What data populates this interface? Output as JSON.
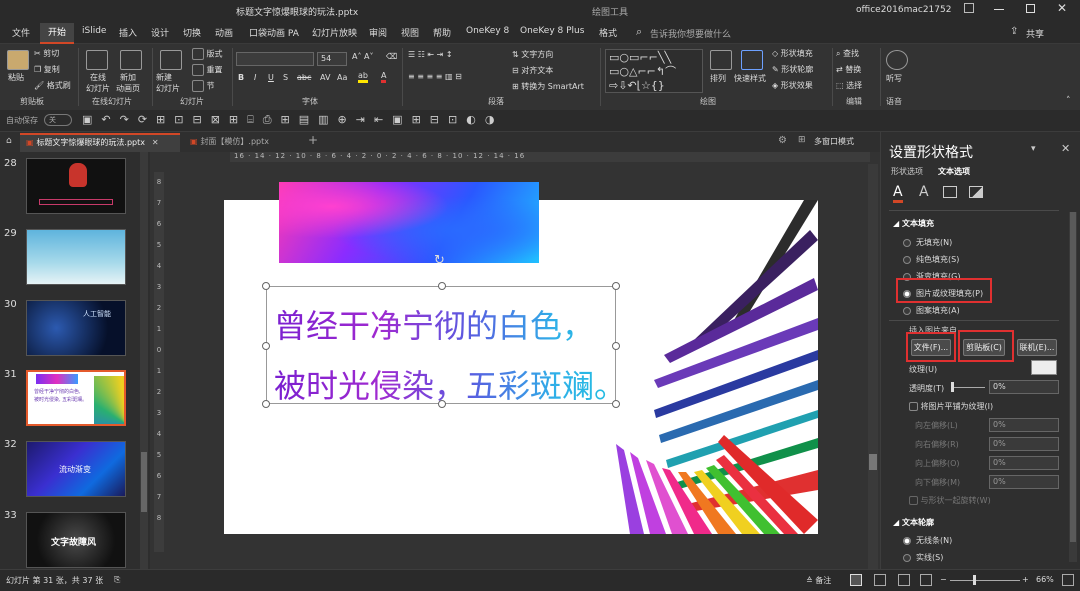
{
  "titlebar": {
    "title": "标题文字惊爆眼球的玩法.pptx",
    "context": "绘图工具",
    "account": "office2016mac21752"
  },
  "menubar": {
    "items": [
      "文件",
      "开始",
      "iSlide",
      "插入",
      "设计",
      "切换",
      "动画",
      "口袋动画 PA",
      "幻灯片放映",
      "审阅",
      "视图",
      "帮助",
      "OneKey 8",
      "OneKey 8 Plus",
      "格式"
    ],
    "search_placeholder": "告诉我你想要做什么",
    "share": "共享"
  },
  "ribbon": {
    "groups": [
      "剪贴板",
      "幻灯片",
      "字体",
      "段落",
      "绘图",
      "编辑",
      "语音"
    ],
    "clipboard": {
      "paste": "粘贴",
      "cut": "剪切",
      "copy": "复制",
      "format_painter": "格式刷"
    },
    "slides": {
      "online": "在线\n幻灯片",
      "new_anim": "新加\n动画页",
      "new_slide": "新建\n幻灯片",
      "layout": "版式",
      "reset": "重置",
      "section": "节"
    },
    "online_group": "在线幻灯片",
    "font": {
      "name": "",
      "size": "54"
    },
    "paragraph": {
      "text_dir": "文字方向",
      "align_text": "对齐文本",
      "smartart": "转换为 SmartArt"
    },
    "drawing": {
      "arrange": "排列",
      "quick_styles": "快速样式",
      "fill": "形状填充",
      "outline": "形状轮廓",
      "effects": "形状效果"
    },
    "editing": {
      "find": "查找",
      "replace": "替换",
      "select": "选择"
    },
    "voice": {
      "dictate": "听写"
    }
  },
  "qat": {
    "autosave": "自动保存",
    "autosave_state": "关"
  },
  "doctabs": [
    {
      "label": "标题文字惊爆眼球的玩法.pptx",
      "active": true
    },
    {
      "label": "封面【模仿】.pptx",
      "active": false
    }
  ],
  "multiwindow": "多窗口模式",
  "ruler": {
    "h": [
      "16",
      "14",
      "12",
      "10",
      "8",
      "6",
      "4",
      "2",
      "0",
      "2",
      "4",
      "6",
      "8",
      "10",
      "12",
      "14",
      "16"
    ],
    "v": [
      "8",
      "7",
      "6",
      "5",
      "4",
      "3",
      "2",
      "1",
      "0",
      "1",
      "2",
      "3",
      "4",
      "5",
      "6",
      "7",
      "8"
    ]
  },
  "thumbnails": [
    {
      "num": "28",
      "text": "",
      "bg": "#111"
    },
    {
      "num": "29",
      "text": "",
      "bg": "#7fc4dd"
    },
    {
      "num": "30",
      "text": "人工智能",
      "bg": "#0a1a3a"
    },
    {
      "num": "31",
      "text": "曾经干净宁彻的白色,\n被时光侵染, 五彩斑斓。",
      "bg": "#ffffff"
    },
    {
      "num": "32",
      "text": "流动渐变",
      "bg": "#1b2a8a"
    },
    {
      "num": "33",
      "text": "文字故障风",
      "bg": "#222"
    }
  ],
  "slide": {
    "line1": "曾经干净宁彻的白色，",
    "line2": "被时光侵染，五彩斑斓。"
  },
  "pane": {
    "title": "设置形状格式",
    "tabs": [
      "形状选项",
      "文本选项"
    ],
    "section_fill": "文本填充",
    "options": [
      "无填充(N)",
      "纯色填充(S)",
      "渐变填充(G)",
      "图片或纹理填充(P)",
      "图案填充(A)"
    ],
    "selected_option": 3,
    "insert_from": "插入图片来自",
    "buttons": {
      "file": "文件(F)...",
      "clipboard": "剪贴板(C)",
      "online": "联机(E)..."
    },
    "texture": "纹理(U)",
    "transparency": "透明度(T)",
    "transparency_value": "0%",
    "tile": "将图片平铺为纹理(I)",
    "offsets": [
      {
        "label": "向左偏移(L)",
        "value": "0%"
      },
      {
        "label": "向右偏移(R)",
        "value": "0%"
      },
      {
        "label": "向上偏移(O)",
        "value": "0%"
      },
      {
        "label": "向下偏移(M)",
        "value": "0%"
      }
    ],
    "rotate_with_shape": "与形状一起旋转(W)",
    "section_outline": "文本轮廓",
    "outline_options": [
      "无线条(N)",
      "实线(S)"
    ]
  },
  "status": {
    "slide_info": "幻灯片 第 31 张，共 37 张",
    "notes": "备注",
    "zoom": "66%"
  }
}
